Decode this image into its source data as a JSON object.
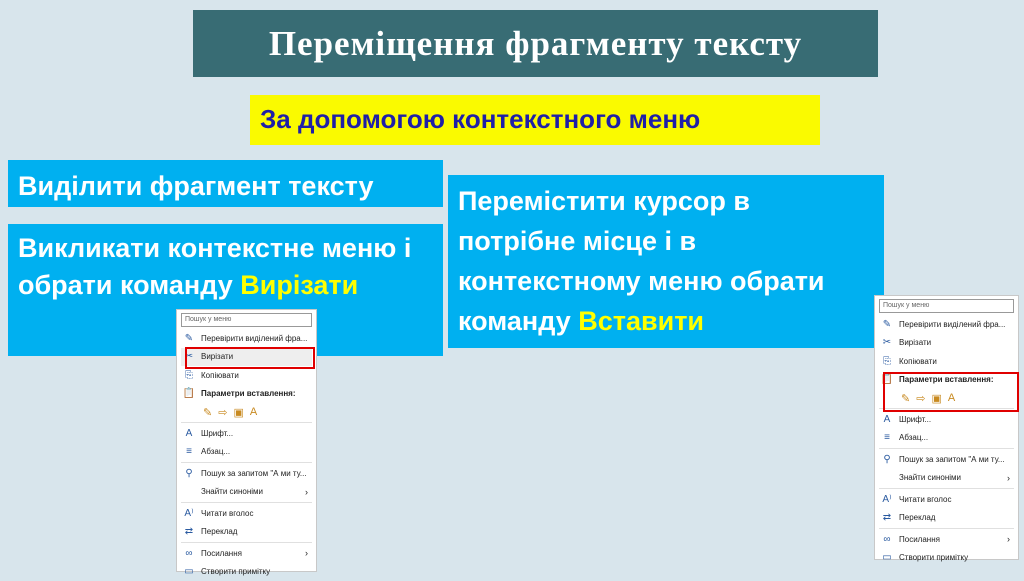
{
  "title": "Переміщення фрагменту тексту",
  "subtitle": "За допомогою контекстного меню",
  "step1": "Виділити фрагмент тексту",
  "step2": {
    "text": "Викликати контекстне меню і обрати команду",
    "highlight": "Вирізати"
  },
  "step3": {
    "text": "Перемістити курсор в потрібне місце і в контекстному меню обрати команду",
    "highlight": "Вставити"
  },
  "menu": {
    "search_placeholder": "Пошук у меню",
    "items": [
      {
        "icon": "pen-icon",
        "glyph": "✎",
        "label": "Перевірити виділений фра..."
      },
      {
        "icon": "scissors-icon",
        "glyph": "✂",
        "label": "Вирізати"
      },
      {
        "icon": "copy-icon",
        "glyph": "⎘",
        "label": "Копіювати"
      },
      {
        "icon": "paste-icon",
        "glyph": "📋",
        "label": "Параметри вставлення:",
        "bold": true
      },
      {
        "paste_options": [
          "✎",
          "⇨",
          "▣",
          "A"
        ]
      },
      {
        "icon": "font-icon",
        "glyph": "A",
        "label": "Шрифт..."
      },
      {
        "icon": "paragraph-icon",
        "glyph": "≡",
        "label": "Абзац..."
      },
      {
        "icon": "search-icon",
        "glyph": "⚲",
        "label": "Пошук за запитом \"А ми ту..."
      },
      {
        "icon": "none",
        "glyph": "",
        "label": "Знайти синоніми",
        "submenu": true
      },
      {
        "icon": "read-aloud-icon",
        "glyph": "A⁾",
        "label": "Читати вголос"
      },
      {
        "icon": "translate-icon",
        "glyph": "⇄",
        "label": "Переклад"
      },
      {
        "icon": "link-icon",
        "glyph": "∞",
        "label": "Посилання",
        "submenu": true
      },
      {
        "icon": "comment-icon",
        "glyph": "▭",
        "label": "Створити примітку"
      }
    ]
  },
  "colors": {
    "title_bg": "#386c74",
    "subtitle_bg": "#fafa00",
    "box_bg": "#00b0f0",
    "highlight": "#ffff00",
    "callout": "#e00000"
  }
}
